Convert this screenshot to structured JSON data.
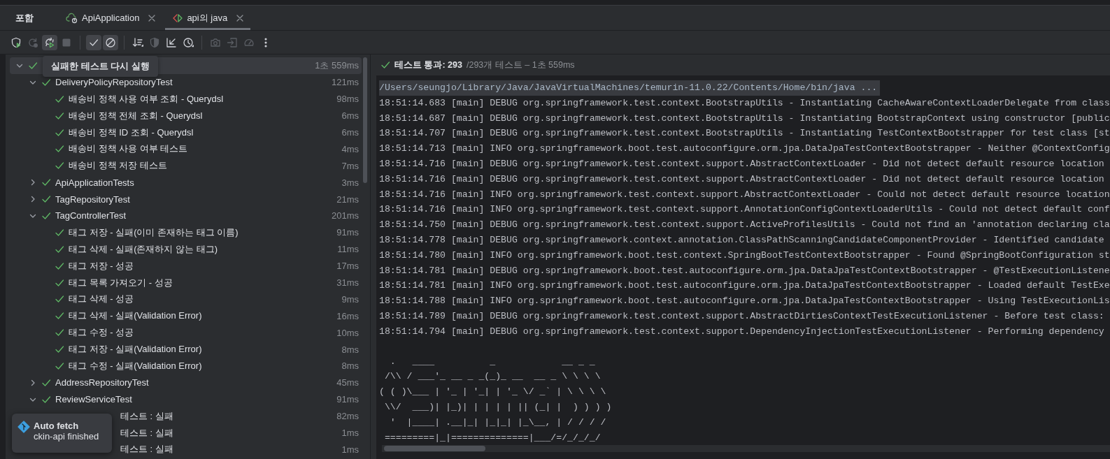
{
  "header_label": "포함",
  "tabs": [
    {
      "label": "ApiApplication",
      "selected": false,
      "kind": "run"
    },
    {
      "label": "api의 java",
      "selected": true,
      "kind": "test"
    }
  ],
  "toolbar": [
    [
      {
        "disabled": false,
        "pressed": false
      },
      {
        "disabled": true,
        "pressed": false
      },
      {
        "disabled": false,
        "pressed": true
      },
      {
        "disabled": true,
        "pressed": false
      }
    ],
    [
      {
        "disabled": false,
        "pressed": true
      },
      {
        "disabled": false,
        "pressed": true
      }
    ],
    [
      {
        "disabled": false,
        "pressed": false
      },
      {
        "disabled": true,
        "pressed": false
      },
      {
        "disabled": false,
        "pressed": false
      },
      {
        "disabled": false,
        "pressed": false
      }
    ],
    [
      {
        "disabled": true,
        "pressed": false
      },
      {
        "disabled": true,
        "pressed": false
      },
      {
        "disabled": true,
        "pressed": false
      },
      {
        "disabled": false,
        "pressed": false
      }
    ]
  ],
  "tooltip": "실패한 테스트 다시 실행",
  "tree": [
    {
      "time": "1초 559ms",
      "passed": true,
      "expanded": true,
      "selected": true,
      "children": [
        {
          "name": "DeliveryPolicyRepositoryTest",
          "time": "121ms",
          "passed": true,
          "expanded": true,
          "selected": false,
          "children": [
            {
              "name": "배송비 정책 사용 여부 조회 - Querydsl",
              "time": "98ms",
              "passed": true,
              "selected": false
            },
            {
              "name": "배송비 정책 전체 조회 - Querydsl",
              "time": "6ms",
              "passed": true,
              "selected": false
            },
            {
              "name": "배송비 정책 ID 조회 - Querydsl",
              "time": "6ms",
              "passed": true,
              "selected": false
            },
            {
              "name": "배송비 정책 사용 여부 테스트",
              "time": "4ms",
              "passed": true,
              "selected": false
            },
            {
              "name": "배송비 정책 저장 테스트",
              "time": "7ms",
              "passed": true,
              "selected": false
            }
          ]
        },
        {
          "name": "ApiApplicationTests",
          "time": "3ms",
          "passed": true,
          "expanded": false,
          "selected": false
        },
        {
          "name": "TagRepositoryTest",
          "time": "21ms",
          "passed": true,
          "expanded": false,
          "selected": false
        },
        {
          "name": "TagControllerTest",
          "time": "201ms",
          "passed": true,
          "expanded": true,
          "selected": false,
          "children": [
            {
              "name": "태그 저장 - 실패(이미 존재하는 태그 이름)",
              "time": "91ms",
              "passed": true,
              "selected": false
            },
            {
              "name": "태그 삭제 - 실패(존재하지 않는 태그)",
              "time": "11ms",
              "passed": true,
              "selected": false
            },
            {
              "name": "태그 저장 - 성공",
              "time": "17ms",
              "passed": true,
              "selected": false
            },
            {
              "name": "태그 목록 가져오기 - 성공",
              "time": "31ms",
              "passed": true,
              "selected": false
            },
            {
              "name": "태그 삭제 - 성공",
              "time": "9ms",
              "passed": true,
              "selected": false
            },
            {
              "name": "태그 삭제 - 실패(Validation Error)",
              "time": "16ms",
              "passed": true,
              "selected": false
            },
            {
              "name": "태그 수정 - 성공",
              "time": "10ms",
              "passed": true,
              "selected": false
            },
            {
              "name": "태그 저장 - 실패(Validation Error)",
              "time": "8ms",
              "passed": true,
              "selected": false
            },
            {
              "name": "태그 수정 - 실패(Validation Error)",
              "time": "8ms",
              "passed": true,
              "selected": false
            }
          ]
        },
        {
          "name": "AddressRepositoryTest",
          "time": "45ms",
          "passed": true,
          "expanded": false,
          "selected": false
        },
        {
          "name": "ReviewServiceTest",
          "time": "91ms",
          "passed": true,
          "expanded": true,
          "selected": false,
          "children": [
            {
              "name": "테스트 : 실패",
              "time": "82ms",
              "selected": false,
              "covered": true
            },
            {
              "name": "테스트 : 실패",
              "time": "1ms",
              "selected": false,
              "covered": true
            },
            {
              "name": "테스트 : 실패",
              "time": "1ms",
              "selected": false,
              "covered": true
            }
          ]
        }
      ]
    }
  ],
  "result": {
    "passed": true,
    "label": "테스트 통과: 293",
    "summary": "/293개 테스트 – 1초 559ms"
  },
  "console": {
    "command": "/Users/seungjo/Library/Java/JavaVirtualMachines/temurin-11.0.22/Contents/Home/bin/java ...",
    "lines": [
      "18:51:14.683 [main] DEBUG org.springframework.test.context.BootstrapUtils - Instantiating CacheAwareContextLoaderDelegate from class",
      "18:51:14.687 [main] DEBUG org.springframework.test.context.BootstrapUtils - Instantiating BootstrapContext using constructor [public",
      "18:51:14.707 [main] DEBUG org.springframework.test.context.BootstrapUtils - Instantiating TestContextBootstrapper for test class [st",
      "18:51:14.713 [main] INFO org.springframework.boot.test.autoconfigure.orm.jpa.DataJpaTestContextBootstrapper - Neither @ContextConfig",
      "18:51:14.716 [main] DEBUG org.springframework.test.context.support.AbstractContextLoader - Did not detect default resource location",
      "18:51:14.716 [main] DEBUG org.springframework.test.context.support.AbstractContextLoader - Did not detect default resource location",
      "18:51:14.716 [main] INFO org.springframework.test.context.support.AbstractContextLoader - Could not detect default resource location",
      "18:51:14.716 [main] INFO org.springframework.test.context.support.AnnotationConfigContextLoaderUtils - Could not detect default conf",
      "18:51:14.750 [main] DEBUG org.springframework.test.context.support.ActiveProfilesUtils - Could not find an 'annotation declaring cla",
      "18:51:14.778 [main] DEBUG org.springframework.context.annotation.ClassPathScanningCandidateComponentProvider - Identified candidate",
      "18:51:14.780 [main] INFO org.springframework.boot.test.context.SpringBootTestContextBootstrapper - Found @SpringBootConfiguration st",
      "18:51:14.781 [main] DEBUG org.springframework.boot.test.autoconfigure.orm.jpa.DataJpaTestContextBootstrapper - @TestExecutionListene",
      "18:51:14.781 [main] INFO org.springframework.boot.test.autoconfigure.orm.jpa.DataJpaTestContextBootstrapper - Loaded default TestExe",
      "18:51:14.788 [main] INFO org.springframework.boot.test.autoconfigure.orm.jpa.DataJpaTestContextBootstrapper - Using TestExecutionLis",
      "18:51:14.789 [main] DEBUG org.springframework.test.context.support.AbstractDirtiesContextTestExecutionListener - Before test class:",
      "18:51:14.794 [main] DEBUG org.springframework.test.context.support.DependencyInjectionTestExecutionListener - Performing dependency"
    ],
    "banner": [
      "  .   ____          _            __ _ _",
      " /\\\\ / ___'_ __ _ _(_)_ __  __ _ \\ \\ \\ \\",
      "( ( )\\___ | '_ | '_| | '_ \\/ _` | \\ \\ \\ \\",
      " \\\\/  ___)| |_)| | | | | || (_| |  ) ) ) )",
      "  '  |____| .__|_| |_|_| |_\\__, | / / / /",
      " =========|_|==============|___/=/_/_/_/"
    ]
  },
  "notification": {
    "title": "Auto fetch",
    "message": "ckin-api finished"
  }
}
